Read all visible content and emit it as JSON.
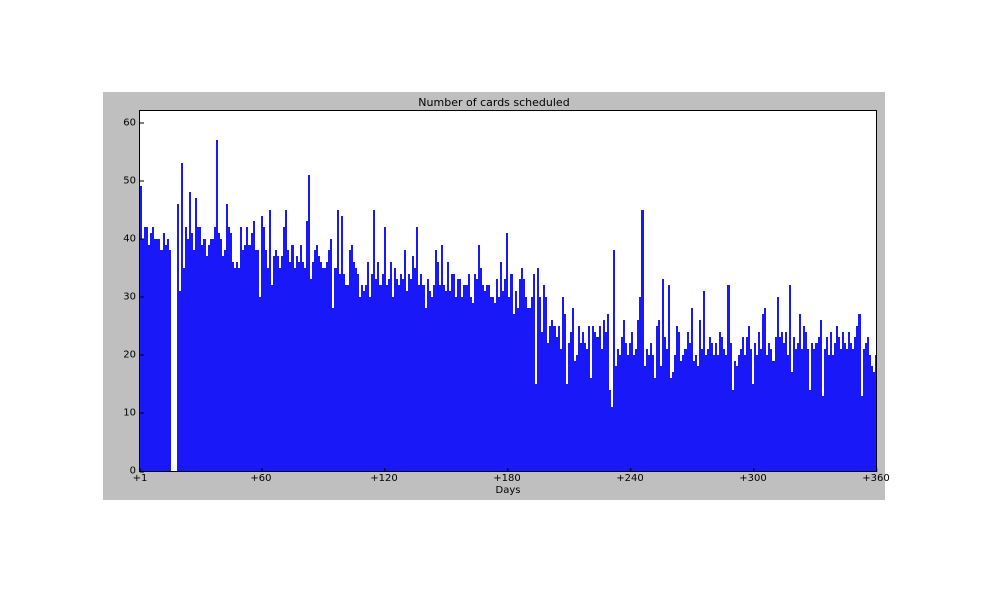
{
  "chart_data": {
    "type": "bar",
    "title": "Number of cards scheduled",
    "xlabel": "Days",
    "ylabel": "",
    "ylim": [
      0,
      62
    ],
    "xlim": [
      1,
      360
    ],
    "yticks": [
      0,
      10,
      20,
      30,
      40,
      50,
      60
    ],
    "xticks": [
      {
        "value": 1,
        "label": "+1"
      },
      {
        "value": 60,
        "label": "+60"
      },
      {
        "value": 120,
        "label": "+120"
      },
      {
        "value": 180,
        "label": "+180"
      },
      {
        "value": 240,
        "label": "+240"
      },
      {
        "value": 300,
        "label": "+300"
      },
      {
        "value": 360,
        "label": "+360"
      }
    ],
    "x_start": 1,
    "x_step": 1,
    "bar_color": "#1818f8",
    "values": [
      49,
      40,
      42,
      42,
      39,
      41,
      42,
      40,
      40,
      40,
      38,
      41,
      39,
      40,
      38,
      0,
      0,
      0,
      46,
      31,
      53,
      35,
      42,
      40,
      48,
      41,
      38,
      47,
      42,
      42,
      39,
      40,
      37,
      39,
      40,
      40,
      42,
      57,
      41,
      40,
      37,
      38,
      46,
      42,
      41,
      36,
      35,
      36,
      35,
      42,
      38,
      39,
      42,
      39,
      41,
      43,
      38,
      38,
      30,
      44,
      42,
      38,
      35,
      45,
      32,
      37,
      38,
      37,
      35,
      37,
      42,
      45,
      38,
      36,
      39,
      35,
      37,
      36,
      39,
      36,
      35,
      43,
      51,
      33,
      36,
      38,
      39,
      37,
      36,
      35,
      35,
      36,
      38,
      40,
      28,
      35,
      45,
      34,
      44,
      34,
      32,
      32,
      38,
      39,
      36,
      35,
      34,
      30,
      32,
      31,
      32,
      36,
      30,
      34,
      45,
      33,
      36,
      32,
      34,
      42,
      32,
      33,
      36,
      30,
      35,
      33,
      32,
      34,
      33,
      38,
      31,
      34,
      33,
      37,
      35,
      42,
      32,
      34,
      32,
      28,
      33,
      31,
      30,
      32,
      38,
      36,
      32,
      39,
      32,
      31,
      36,
      31,
      34,
      34,
      30,
      33,
      33,
      30,
      32,
      32,
      34,
      30,
      29,
      34,
      33,
      39,
      35,
      32,
      31,
      32,
      32,
      30,
      30,
      29,
      33,
      30,
      36,
      31,
      33,
      41,
      30,
      34,
      27,
      31,
      28,
      33,
      35,
      33,
      30,
      28,
      28,
      30,
      34,
      15,
      35,
      30,
      24,
      32,
      30,
      22,
      25,
      26,
      25,
      23,
      25,
      21,
      30,
      27,
      15,
      22,
      24,
      28,
      19,
      20,
      25,
      22,
      24,
      22,
      21,
      25,
      16,
      25,
      24,
      23,
      25,
      21,
      26,
      24,
      27,
      14,
      11,
      38,
      18,
      21,
      20,
      23,
      26,
      22,
      20,
      22,
      24,
      20,
      21,
      26,
      30,
      45,
      18,
      21,
      20,
      22,
      20,
      16,
      25,
      26,
      18,
      33,
      23,
      21,
      32,
      16,
      17,
      20,
      25,
      24,
      19,
      20,
      21,
      24,
      22,
      28,
      19,
      20,
      18,
      26,
      21,
      31,
      20,
      21,
      23,
      22,
      20,
      22,
      20,
      24,
      23,
      21,
      20,
      32,
      22,
      14,
      19,
      18,
      20,
      21,
      23,
      20,
      23,
      25,
      21,
      15,
      22,
      20,
      24,
      21,
      27,
      28,
      20,
      22,
      21,
      19,
      23,
      30,
      23,
      24,
      22,
      24,
      20,
      32,
      17,
      23,
      21,
      22,
      27,
      21,
      25,
      24,
      21,
      14,
      22,
      21,
      22,
      23,
      26,
      13,
      21,
      23,
      20,
      24,
      20,
      22,
      25,
      23,
      21,
      24,
      22,
      21,
      24,
      22,
      21,
      23,
      25,
      27,
      13,
      21,
      22,
      23,
      20,
      18,
      17,
      20
    ]
  }
}
